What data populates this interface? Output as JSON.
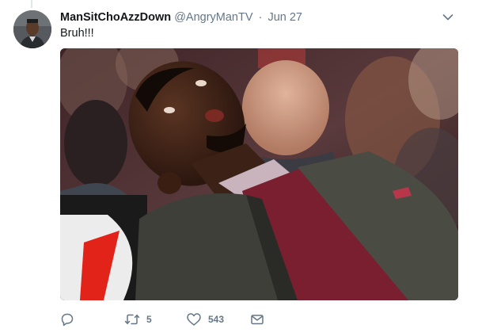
{
  "tweet": {
    "display_name": "ManSitChoAzzDown",
    "handle": "@AngryManTV",
    "separator": "·",
    "date": "Jun 27",
    "text": "Bruh!!!"
  },
  "actions": {
    "reply_icon": "reply-icon",
    "retweet_icon": "retweet-icon",
    "retweet_count": "5",
    "like_icon": "heart-icon",
    "like_count": "543",
    "dm_icon": "envelope-icon"
  },
  "colors": {
    "text_primary": "#14171a",
    "text_secondary": "#657786",
    "divider": "#e1e8ed"
  }
}
